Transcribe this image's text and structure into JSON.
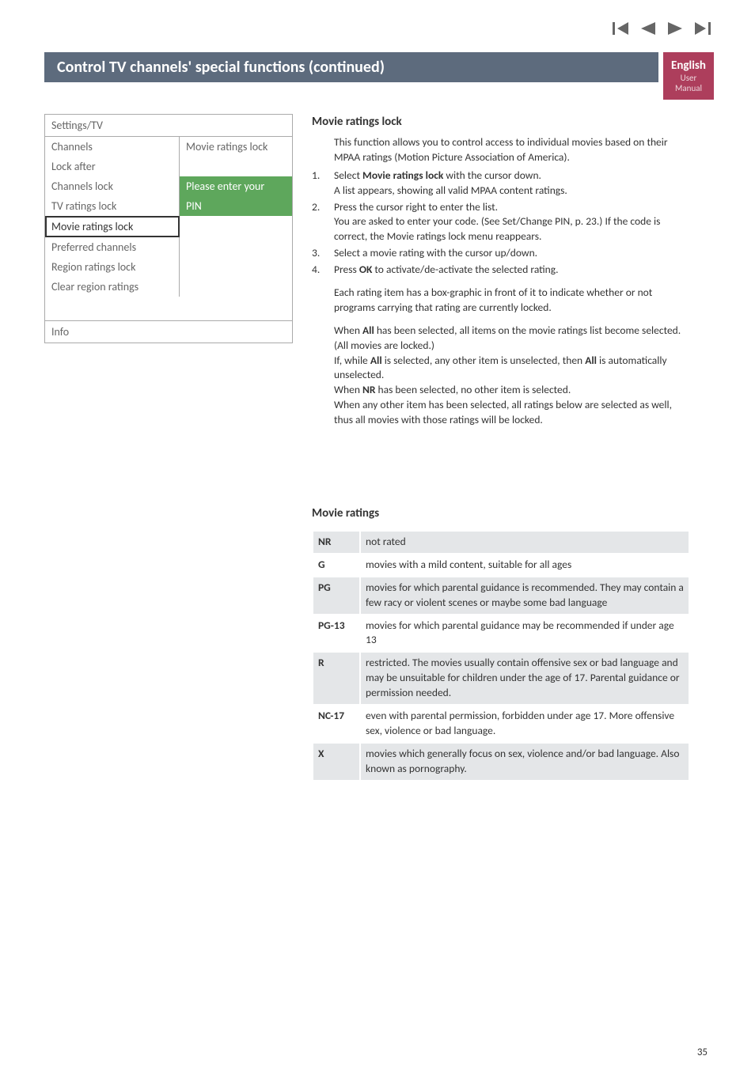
{
  "nav_icons": {
    "first": "first-icon",
    "prev": "prev-icon",
    "next": "next-icon",
    "last": "last-icon"
  },
  "title_bar": "Control TV channels' special functions   (continued)",
  "sidebar_label": {
    "line1": "English",
    "line2": "User Manual"
  },
  "settings_box": {
    "header": "Settings/TV",
    "rows": [
      {
        "left": "Channels",
        "right": "Movie ratings lock"
      },
      {
        "left": "Lock after",
        "right": ""
      },
      {
        "left": "Channels lock",
        "right": "Please enter your",
        "right_green": true
      },
      {
        "left": "TV ratings lock",
        "right": "PIN",
        "right_green": true
      },
      {
        "left": "Movie ratings lock",
        "right": "",
        "selected": true
      },
      {
        "left": "Preferred channels",
        "right": ""
      },
      {
        "left": "Region ratings lock",
        "right": ""
      },
      {
        "left": "Clear region ratings",
        "right": ""
      }
    ],
    "info": "Info"
  },
  "main": {
    "heading": "Movie ratings lock",
    "intro": "This function allows you to control access to individual movies based on their MPAA ratings (Motion Picture Association of America).",
    "steps": [
      {
        "n": "1.",
        "text_before": "Select ",
        "bold1": "Movie ratings lock",
        "text_mid": " with the cursor down.",
        "text_after": "A list appears, showing all valid MPAA content ratings."
      },
      {
        "n": "2.",
        "text_before": "Press the cursor right to enter the list.",
        "text_after": "You are asked to enter your code. (See Set/Change PIN, p. 23.) If the code is correct, the Movie ratings lock menu reappears."
      },
      {
        "n": "3.",
        "text_before": "Select a movie rating with the cursor up/down."
      },
      {
        "n": "4.",
        "text_before": "Press ",
        "bold1": "OK",
        "text_mid": " to activate/de-activate the selected rating."
      }
    ],
    "note1": "Each rating item has a box-graphic in front of it to indicate whether or not programs carrying that rating are currently locked.",
    "note2_a": "When ",
    "note2_b": "All",
    "note2_c": " has been selected, all items on the movie ratings list become selected. (All movies are locked.)",
    "note3_a": "If, while ",
    "note3_b": "All",
    "note3_c": " is selected, any other item is unselected, then ",
    "note3_d": "All",
    "note3_e": " is automatically unselected.",
    "note4_a": "When ",
    "note4_b": "NR",
    "note4_c": " has been selected, no other item is selected.",
    "note5": "When any other item has been selected, all ratings below are selected as well, thus all movies with those ratings will be locked."
  },
  "ratings": {
    "heading": "Movie ratings",
    "rows": [
      {
        "code": "NR",
        "desc": "not rated"
      },
      {
        "code": "G",
        "desc": "movies with a mild content, suitable for all ages"
      },
      {
        "code": "PG",
        "desc": "movies for which parental guidance is recommended. They may contain a few racy or violent scenes or maybe some bad language"
      },
      {
        "code": "PG-13",
        "desc": "movies for which parental guidance may be recommended if under age 13"
      },
      {
        "code": "R",
        "desc": "restricted. The movies usually contain offensive sex or bad language and may be unsuitable for children under the age of 17. Parental guidance or permission needed."
      },
      {
        "code": "NC-17",
        "desc": "even with parental permission, forbidden under age 17. More offensive sex, violence or bad language."
      },
      {
        "code": "X",
        "desc": "movies which generally focus on sex, violence and/or bad language. Also known as pornography."
      }
    ]
  },
  "page_number": "35"
}
